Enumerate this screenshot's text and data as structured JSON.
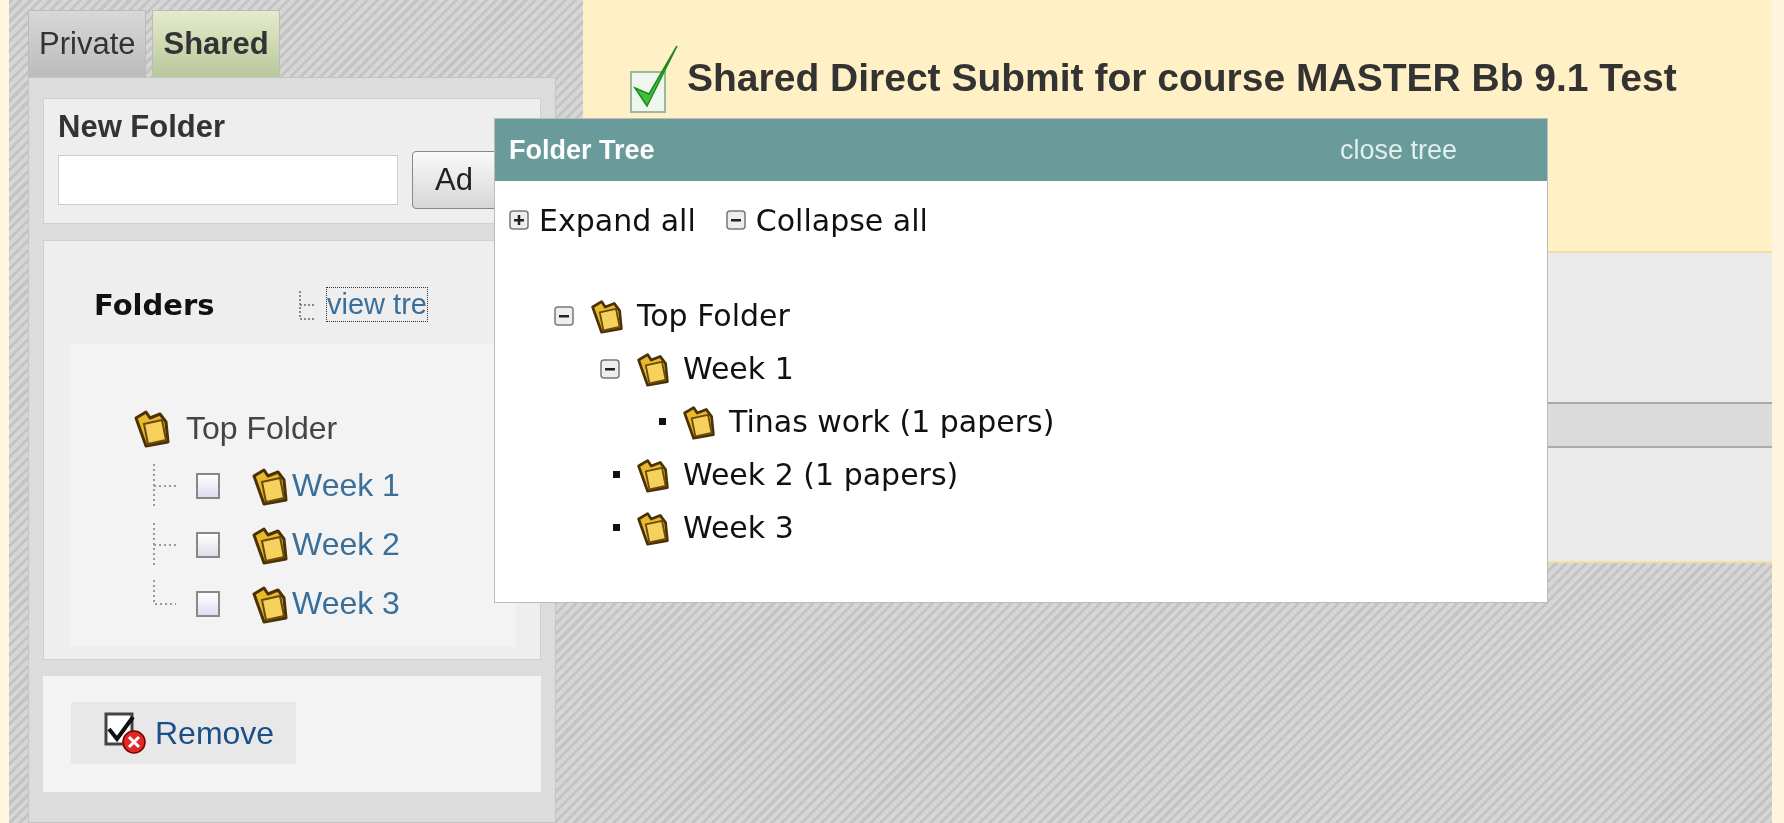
{
  "tabs": [
    {
      "label": "Private",
      "selected": false
    },
    {
      "label": "Shared",
      "selected": true
    }
  ],
  "new_folder": {
    "label": "New Folder",
    "button": "Ad"
  },
  "folders": {
    "title": "Folders",
    "view_tree_link": "view tre",
    "root": "Top Folder",
    "items": [
      {
        "label": "Week 1",
        "checked": false
      },
      {
        "label": "Week 2",
        "checked": false
      },
      {
        "label": "Week 3",
        "checked": false
      }
    ]
  },
  "remove_button": "Remove",
  "banner": {
    "title": "Shared Direct Submit for course MASTER Bb 9.1 Test"
  },
  "folder_tree_popup": {
    "title": "Folder Tree",
    "close_link": "close tree",
    "expand_all": "Expand all",
    "collapse_all": "Collapse all",
    "tree": [
      {
        "label": "Top Folder",
        "expanded": true,
        "children": [
          {
            "label": "Week 1",
            "expanded": true,
            "children": [
              {
                "label": "Tinas work (1 papers)"
              }
            ]
          },
          {
            "label": "Week 2 (1 papers)"
          },
          {
            "label": "Week 3"
          }
        ]
      }
    ]
  }
}
